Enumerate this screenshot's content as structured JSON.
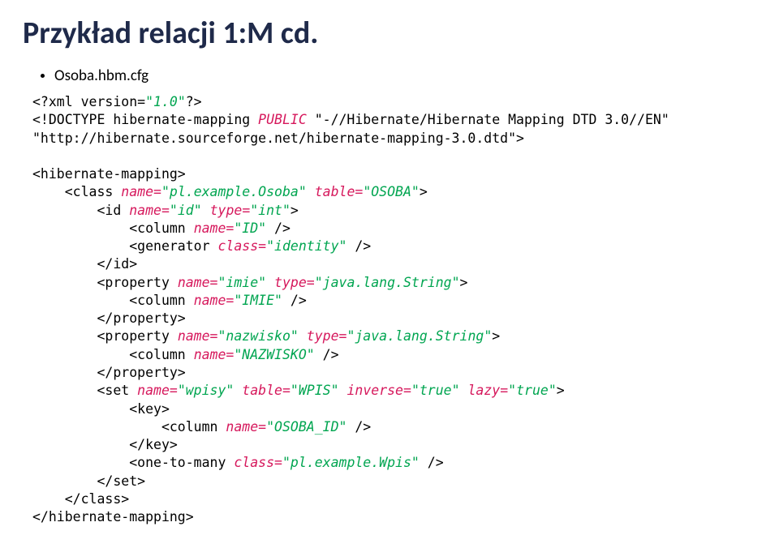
{
  "title": "Przykład relacji 1:M cd.",
  "filename": "Osoba.hbm.cfg",
  "code_lines": [
    [
      {
        "t": "<?xml version=",
        "c": ""
      },
      {
        "t": "\"1.0\"",
        "c": "s"
      },
      {
        "t": "?>",
        "c": ""
      }
    ],
    [
      {
        "t": "<!DOCTYPE hibernate-mapping ",
        "c": ""
      },
      {
        "t": "PUBLIC",
        "c": "a"
      },
      {
        "t": " \"-//Hibernate/Hibernate Mapping DTD 3.0//EN\"",
        "c": ""
      }
    ],
    [
      {
        "t": "\"http://hibernate.sourceforge.net/hibernate-mapping-3.0.dtd\">",
        "c": ""
      }
    ],
    [
      {
        "t": "",
        "c": ""
      }
    ],
    [
      {
        "t": "<hibernate-mapping>",
        "c": ""
      }
    ],
    [
      {
        "t": "    <class ",
        "c": ""
      },
      {
        "t": "name=",
        "c": "a"
      },
      {
        "t": "\"pl.example.Osoba\"",
        "c": "s"
      },
      {
        "t": " ",
        "c": ""
      },
      {
        "t": "table=",
        "c": "a"
      },
      {
        "t": "\"OSOBA\"",
        "c": "s"
      },
      {
        "t": ">",
        "c": ""
      }
    ],
    [
      {
        "t": "        <id ",
        "c": ""
      },
      {
        "t": "name=",
        "c": "a"
      },
      {
        "t": "\"id\"",
        "c": "s"
      },
      {
        "t": " ",
        "c": ""
      },
      {
        "t": "type=",
        "c": "a"
      },
      {
        "t": "\"int\"",
        "c": "s"
      },
      {
        "t": ">",
        "c": ""
      }
    ],
    [
      {
        "t": "            <column ",
        "c": ""
      },
      {
        "t": "name=",
        "c": "a"
      },
      {
        "t": "\"ID\"",
        "c": "s"
      },
      {
        "t": " />",
        "c": ""
      }
    ],
    [
      {
        "t": "            <generator ",
        "c": ""
      },
      {
        "t": "class=",
        "c": "a"
      },
      {
        "t": "\"identity\"",
        "c": "s"
      },
      {
        "t": " />",
        "c": ""
      }
    ],
    [
      {
        "t": "        </id>",
        "c": ""
      }
    ],
    [
      {
        "t": "        <property ",
        "c": ""
      },
      {
        "t": "name=",
        "c": "a"
      },
      {
        "t": "\"imie\"",
        "c": "s"
      },
      {
        "t": " ",
        "c": ""
      },
      {
        "t": "type=",
        "c": "a"
      },
      {
        "t": "\"java.lang.String\"",
        "c": "s"
      },
      {
        "t": ">",
        "c": ""
      }
    ],
    [
      {
        "t": "            <column ",
        "c": ""
      },
      {
        "t": "name=",
        "c": "a"
      },
      {
        "t": "\"IMIE\"",
        "c": "s"
      },
      {
        "t": " />",
        "c": ""
      }
    ],
    [
      {
        "t": "        </property>",
        "c": ""
      }
    ],
    [
      {
        "t": "        <property ",
        "c": ""
      },
      {
        "t": "name=",
        "c": "a"
      },
      {
        "t": "\"nazwisko\"",
        "c": "s"
      },
      {
        "t": " ",
        "c": ""
      },
      {
        "t": "type=",
        "c": "a"
      },
      {
        "t": "\"java.lang.String\"",
        "c": "s"
      },
      {
        "t": ">",
        "c": ""
      }
    ],
    [
      {
        "t": "            <column ",
        "c": ""
      },
      {
        "t": "name=",
        "c": "a"
      },
      {
        "t": "\"NAZWISKO\"",
        "c": "s"
      },
      {
        "t": " />",
        "c": ""
      }
    ],
    [
      {
        "t": "        </property>",
        "c": ""
      }
    ],
    [
      {
        "t": "        <set ",
        "c": ""
      },
      {
        "t": "name=",
        "c": "a"
      },
      {
        "t": "\"wpisy\"",
        "c": "s"
      },
      {
        "t": " ",
        "c": ""
      },
      {
        "t": "table=",
        "c": "a"
      },
      {
        "t": "\"WPIS\"",
        "c": "s"
      },
      {
        "t": " ",
        "c": ""
      },
      {
        "t": "inverse=",
        "c": "a"
      },
      {
        "t": "\"true\"",
        "c": "s"
      },
      {
        "t": " ",
        "c": ""
      },
      {
        "t": "lazy=",
        "c": "a"
      },
      {
        "t": "\"true\"",
        "c": "s"
      },
      {
        "t": ">",
        "c": ""
      }
    ],
    [
      {
        "t": "            <key>",
        "c": ""
      }
    ],
    [
      {
        "t": "                <column ",
        "c": ""
      },
      {
        "t": "name=",
        "c": "a"
      },
      {
        "t": "\"OSOBA_ID\"",
        "c": "s"
      },
      {
        "t": " />",
        "c": ""
      }
    ],
    [
      {
        "t": "            </key>",
        "c": ""
      }
    ],
    [
      {
        "t": "            <one-to-many ",
        "c": ""
      },
      {
        "t": "class=",
        "c": "a"
      },
      {
        "t": "\"pl.example.Wpis\"",
        "c": "s"
      },
      {
        "t": " />",
        "c": ""
      }
    ],
    [
      {
        "t": "        </set>",
        "c": ""
      }
    ],
    [
      {
        "t": "    </class>",
        "c": ""
      }
    ],
    [
      {
        "t": "</hibernate-mapping>",
        "c": ""
      }
    ]
  ]
}
